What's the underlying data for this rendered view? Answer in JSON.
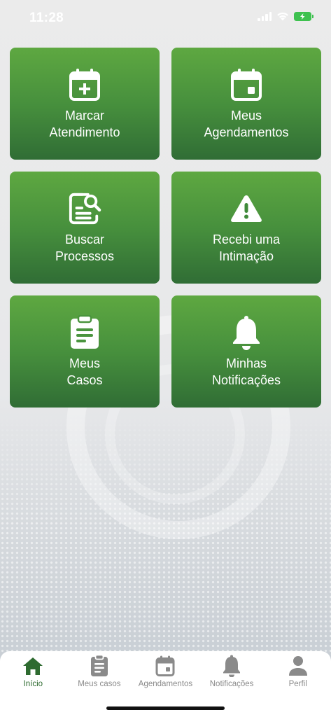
{
  "status_bar": {
    "time": "11:28"
  },
  "colors": {
    "card_top": "#5ea841",
    "card_bottom": "#306d35",
    "tab_active": "#2e6b30",
    "tab_inactive": "#8a8a8a"
  },
  "cards": [
    {
      "icon": "calendar-plus-icon",
      "label": "Marcar\nAtendimento"
    },
    {
      "icon": "calendar-event-icon",
      "label": "Meus\nAgendamentos"
    },
    {
      "icon": "document-search-icon",
      "label": "Buscar\nProcessos"
    },
    {
      "icon": "warning-triangle-icon",
      "label": "Recebi uma\nIntimação"
    },
    {
      "icon": "clipboard-icon",
      "label": "Meus\nCasos"
    },
    {
      "icon": "bell-icon",
      "label": "Minhas\nNotificações"
    }
  ],
  "tab_bar": {
    "active": "Início",
    "items": [
      {
        "icon": "home-icon",
        "label": "Início"
      },
      {
        "icon": "clipboard-icon",
        "label": "Meus casos"
      },
      {
        "icon": "calendar-icon",
        "label": "Agendamentos"
      },
      {
        "icon": "bell-icon",
        "label": "Notificações"
      },
      {
        "icon": "user-icon",
        "label": "Perfil"
      }
    ]
  }
}
